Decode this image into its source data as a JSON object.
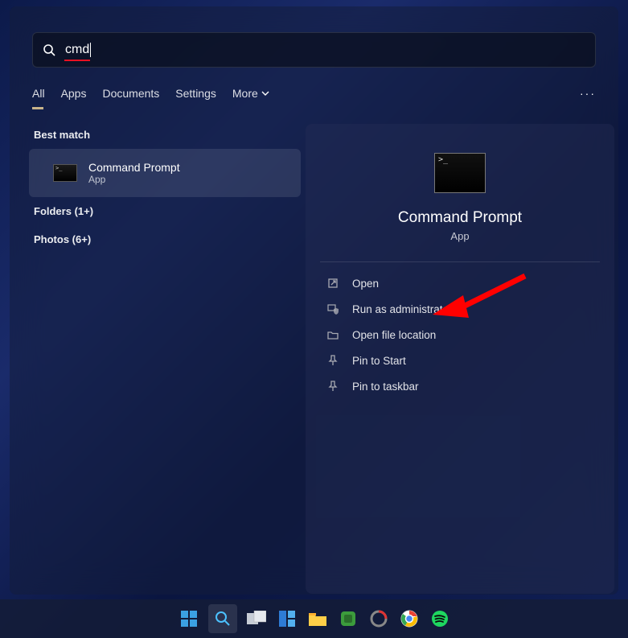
{
  "search": {
    "query": "cmd"
  },
  "tabs": {
    "all": "All",
    "apps": "Apps",
    "documents": "Documents",
    "settings": "Settings",
    "more": "More"
  },
  "left": {
    "best_match_heading": "Best match",
    "result_title": "Command Prompt",
    "result_subtitle": "App",
    "folders_row": "Folders (1+)",
    "photos_row": "Photos (6+)"
  },
  "preview": {
    "title": "Command Prompt",
    "subtitle": "App",
    "actions": {
      "open": "Open",
      "run_admin": "Run as administrator",
      "open_location": "Open file location",
      "pin_start": "Pin to Start",
      "pin_taskbar": "Pin to taskbar"
    }
  }
}
